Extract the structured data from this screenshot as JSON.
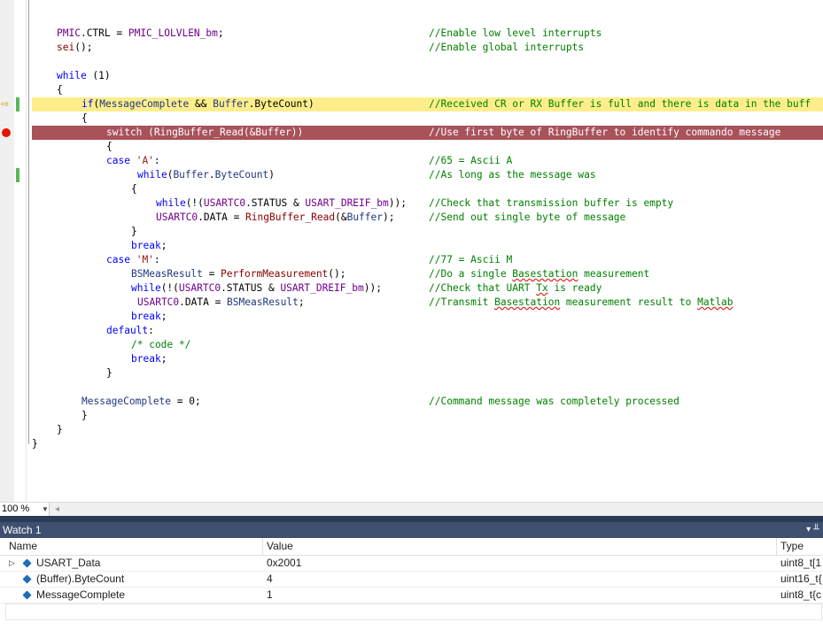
{
  "code_lines": [
    {
      "code_html": "<span class=\"mac\">PMIC</span>.CTRL = <span class=\"mac\">PMIC_LOLVLEN_bm</span>;",
      "indent": 28,
      "comment": "//Enable low level interrupts"
    },
    {
      "code_html": "<span class=\"fn\">sei</span>();",
      "indent": 28,
      "comment": "//Enable global interrupts"
    },
    {
      "code_html": "",
      "indent": 28,
      "comment": ""
    },
    {
      "code_html": "<span class=\"kw\">while</span> (1)",
      "indent": 28,
      "comment": ""
    },
    {
      "code_html": "{",
      "indent": 28,
      "comment": ""
    },
    {
      "code_html": "<span class=\"kw\">if</span>(<span class=\"id\">MessageComplete</span> &amp;&amp; <span class=\"id\">Buffer</span>.ByteCount)",
      "indent": 56,
      "comment": "//Received CR or RX Buffer is full and there is data in the buff"
    },
    {
      "code_html": "{",
      "indent": 56,
      "comment": ""
    },
    {
      "code_html": "switch (RingBuffer_Read(&amp;Buffer))",
      "indent": 84,
      "comment": "//Use first byte of RingBuffer to identify commando message"
    },
    {
      "code_html": "{",
      "indent": 84,
      "comment": ""
    },
    {
      "code_html": "<span class=\"kw\">case</span> <span class=\"str\">'A'</span>:",
      "indent": 84,
      "comment": "//65 = Ascii A"
    },
    {
      "code_html": "<span class=\"kw\">while</span>(<span class=\"id\">Buffer</span>.<span class=\"id\">ByteCount</span>)",
      "indent": 119,
      "comment": "//As long as the message was"
    },
    {
      "code_html": "{",
      "indent": 112,
      "comment": ""
    },
    {
      "code_html": "<span class=\"kw\">while</span>(!(<span class=\"mac\">USARTC0</span>.STATUS &amp; <span class=\"mac\">USART_DREIF_bm</span>));",
      "indent": 140,
      "comment": "//Check that transmission buffer is empty"
    },
    {
      "code_html": "<span class=\"mac\">USARTC0</span>.DATA = <span class=\"fn\">RingBuffer_Read</span>(&amp;<span class=\"id\">Buffer</span>);",
      "indent": 140,
      "comment": "//Send out single byte of message"
    },
    {
      "code_html": "}",
      "indent": 112,
      "comment": ""
    },
    {
      "code_html": "<span class=\"kw\">break</span>;",
      "indent": 112,
      "comment": ""
    },
    {
      "code_html": "<span class=\"kw\">case</span> <span class=\"str\">'M'</span>:",
      "indent": 84,
      "comment": "//77 = Ascii M"
    },
    {
      "code_html": "<span class=\"id\">BSMeasResult</span> = <span class=\"fn\">PerformMeasurement</span>();",
      "indent": 112,
      "comment": "//Do a single <u class=\"squig\">Basestation</u> measurement"
    },
    {
      "code_html": "<span class=\"kw\">while</span>(!(<span class=\"mac\">USARTC0</span>.STATUS &amp; <span class=\"mac\">USART_DREIF_bm</span>));",
      "indent": 112,
      "comment": "//Check that UART <u class=\"squig\">Tx</u> is ready"
    },
    {
      "code_html": "<span class=\"mac\">USARTC0</span>.DATA = <span class=\"id\">BSMeasResult</span>;",
      "indent": 119,
      "comment": "//Transmit <u class=\"squig\">Basestation</u> measurement result to <u class=\"squig\">Matlab</u>"
    },
    {
      "code_html": "<span class=\"kw\">break</span>;",
      "indent": 112,
      "comment": ""
    },
    {
      "code_html": "<span class=\"kw\">default</span>:",
      "indent": 84,
      "comment": ""
    },
    {
      "code_html": "<span class=\"cmt\" style=\"position:static\">/* code */</span>",
      "indent": 112,
      "comment": ""
    },
    {
      "code_html": "<span class=\"kw\">break</span>;",
      "indent": 112,
      "comment": ""
    },
    {
      "code_html": "}",
      "indent": 84,
      "comment": ""
    },
    {
      "code_html": "",
      "indent": 0,
      "comment": ""
    },
    {
      "code_html": "<span class=\"id\">MessageComplete</span> = 0;",
      "indent": 56,
      "comment": "//Command message was completely processed"
    },
    {
      "code_html": "}",
      "indent": 56,
      "comment": ""
    },
    {
      "code_html": "}",
      "indent": 28,
      "comment": ""
    },
    {
      "code_html": "}",
      "indent": 0,
      "comment": ""
    }
  ],
  "zoom": {
    "value": "100 %"
  },
  "watch": {
    "title": "Watch 1",
    "controls": "▾ ╨",
    "columns": {
      "name": "Name",
      "value": "Value",
      "type": "Type"
    },
    "rows": [
      {
        "name": "USART_Data",
        "value": "0x2001",
        "type": "uint8_t[1",
        "expandable": true
      },
      {
        "name": "(Buffer).ByteCount",
        "value": "4",
        "type": "uint16_t{",
        "expandable": false
      },
      {
        "name": "MessageComplete",
        "value": "1",
        "type": "uint8_t{c",
        "expandable": false
      }
    ]
  }
}
